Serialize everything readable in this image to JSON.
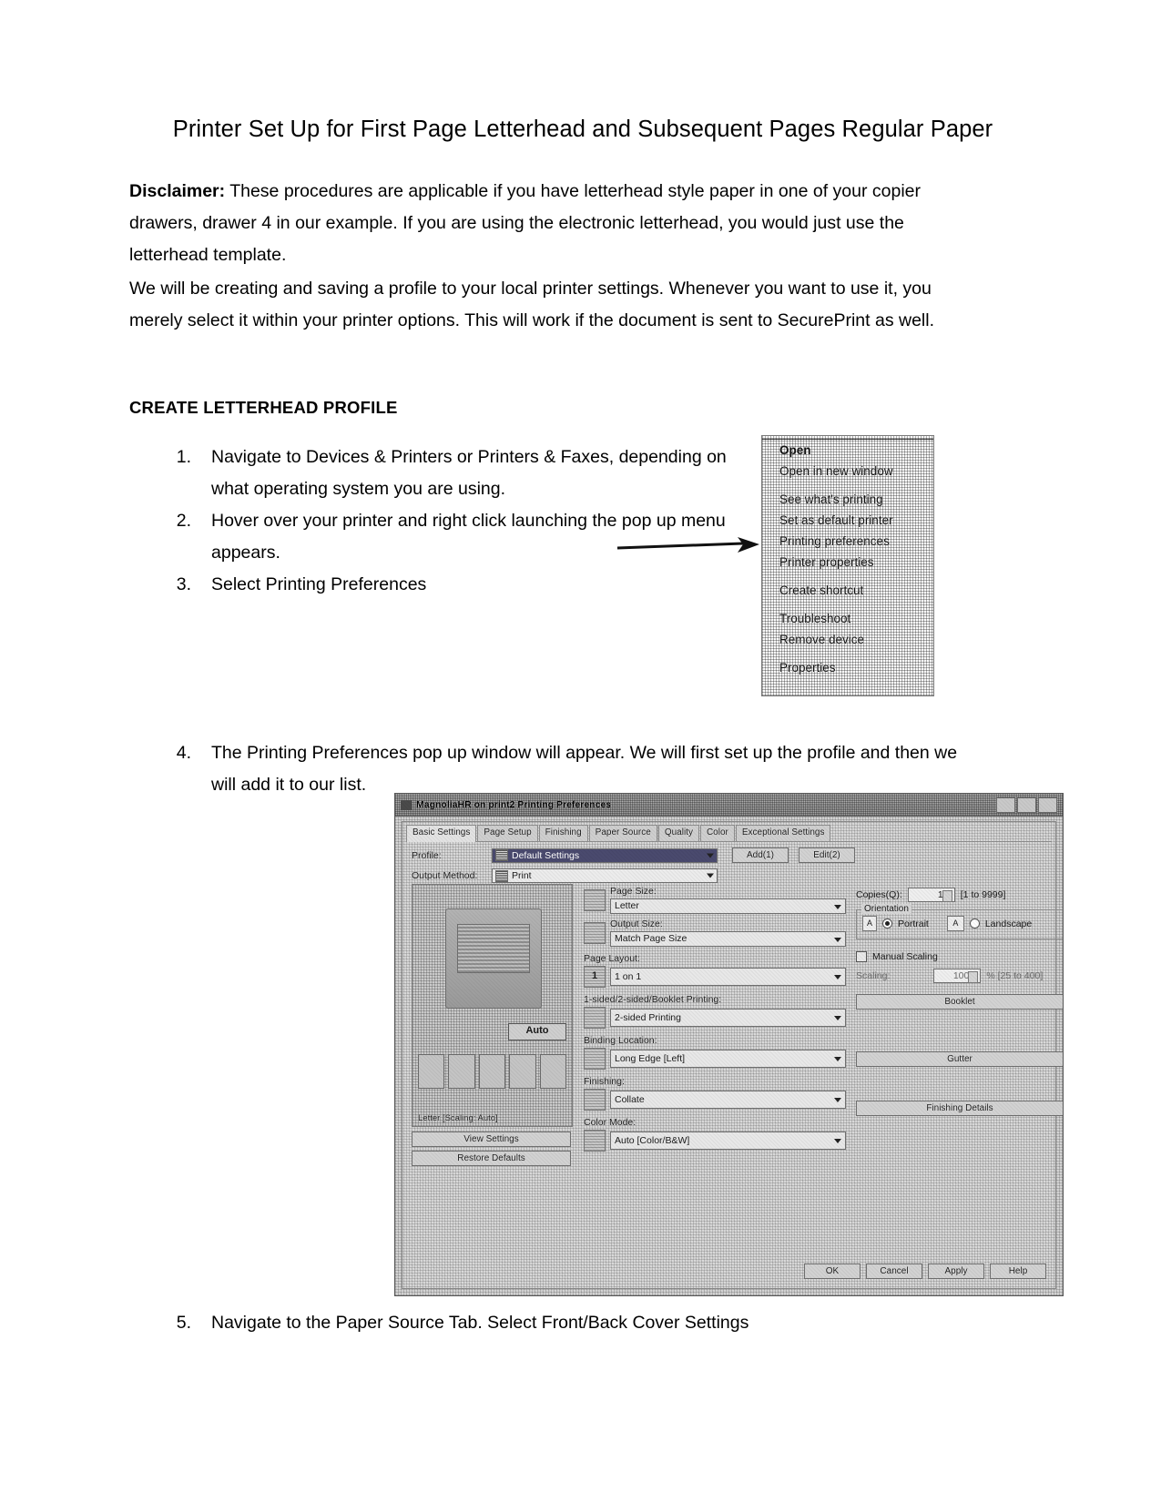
{
  "document": {
    "title": "Printer Set Up for First Page Letterhead and Subsequent Pages Regular Paper",
    "disclaimer_label": "Disclaimer:",
    "disclaimer_text": " These procedures are applicable if you have letterhead style paper in one of your copier drawers, drawer 4 in our example. If you are using the electronic letterhead, you would just use the letterhead template.",
    "paragraph2": "We will be creating and saving a profile to your local printer settings.  Whenever you want to use it, you merely select it within your printer options. This will work if the document is sent to SecurePrint as well.",
    "section_heading": "CREATE LETTERHEAD PROFILE",
    "steps": [
      {
        "num": "1.",
        "text": "Navigate to Devices & Printers or Printers & Faxes, depending on what operating system you are using."
      },
      {
        "num": "2.",
        "text": "Hover over your printer and right click launching the pop up menu appears."
      },
      {
        "num": "3.",
        "text": "Select Printing Preferences"
      },
      {
        "num": "4.",
        "text": "The Printing Preferences pop up window will appear. We will first set up the profile and then we will add it to our list."
      },
      {
        "num": "5.",
        "text": "Navigate to the Paper Source Tab. Select Front/Back Cover Settings"
      }
    ]
  },
  "context_menu": {
    "items": [
      {
        "label": "Open",
        "bold": true
      },
      {
        "label": "Open in new window",
        "bold": false
      },
      {
        "label": "See what's printing",
        "bold": false
      },
      {
        "label": "Set as default printer",
        "bold": false
      },
      {
        "label": "Printing preferences",
        "bold": false
      },
      {
        "label": "Printer properties",
        "bold": false
      },
      {
        "label": "Create shortcut",
        "bold": false
      },
      {
        "label": "Troubleshoot",
        "bold": false
      },
      {
        "label": "Remove device",
        "bold": false
      },
      {
        "label": "Properties",
        "bold": false
      }
    ]
  },
  "dialog": {
    "title": "MagnoliaHR on print2 Printing Preferences",
    "tabs": [
      {
        "label": "Basic Settings",
        "active": true
      },
      {
        "label": "Page Setup",
        "active": false
      },
      {
        "label": "Finishing",
        "active": false
      },
      {
        "label": "Paper Source",
        "active": false
      },
      {
        "label": "Quality",
        "active": false
      },
      {
        "label": "Color",
        "active": false
      },
      {
        "label": "Exceptional Settings",
        "active": false
      }
    ],
    "profile_label": "Profile:",
    "profile_value": "Default Settings",
    "add_button": "Add(1)",
    "edit_button": "Edit(2)",
    "output_method_label": "Output Method:",
    "output_method_value": "Print",
    "preview_caption": "Letter [Scaling: Auto]",
    "auto_button": "Auto",
    "view_settings_button": "View Settings",
    "restore_defaults_button": "Restore Defaults",
    "fields": {
      "page_size_label": "Page Size:",
      "page_size_value": "Letter",
      "output_size_label": "Output Size:",
      "output_size_value": "Match Page Size",
      "page_layout_label": "Page Layout:",
      "page_layout_value": "1 on 1",
      "page_layout_badge": "1",
      "sided_label": "1-sided/2-sided/Booklet Printing:",
      "sided_value": "2-sided Printing",
      "binding_label": "Binding Location:",
      "binding_value": "Long Edge [Left]",
      "finishing_label": "Finishing:",
      "finishing_value": "Collate",
      "color_mode_label": "Color Mode:",
      "color_mode_value": "Auto [Color/B&W]"
    },
    "right": {
      "copies_label": "Copies(Q):",
      "copies_value": "1",
      "copies_range": "[1 to 9999]",
      "orientation_label": "Orientation",
      "portrait_label": "Portrait",
      "landscape_label": "Landscape",
      "portrait_glyph": "A",
      "landscape_glyph": "A",
      "manual_scaling_label": "Manual Scaling",
      "scaling_label": "Scaling:",
      "scaling_value": "100",
      "scaling_range": "% [25 to 400]",
      "booklet_button": "Booklet",
      "gutter_button": "Gutter",
      "finishing_details_button": "Finishing Details"
    },
    "footer": {
      "ok": "OK",
      "cancel": "Cancel",
      "apply": "Apply",
      "help": "Help"
    }
  }
}
